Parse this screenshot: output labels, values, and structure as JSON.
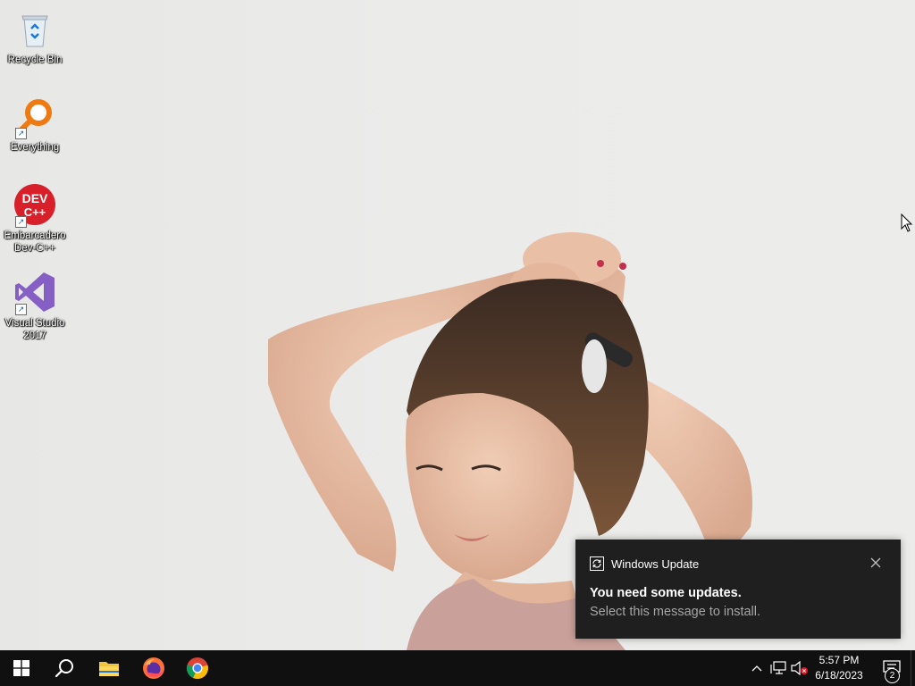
{
  "desktop": {
    "icons": [
      {
        "label": "Recycle Bin",
        "icon": "recycle-bin-icon"
      },
      {
        "label": "Everything",
        "icon": "everything-search-icon"
      },
      {
        "label": "Embarcadero Dev-C++",
        "icon": "devcpp-icon",
        "glyph_text": "DEV C++"
      },
      {
        "label": "Visual Studio 2017",
        "icon": "visual-studio-icon"
      }
    ]
  },
  "notification": {
    "app_name": "Windows Update",
    "title": "You need some updates.",
    "body": "Select this message to install.",
    "close_glyph": "✕"
  },
  "taskbar": {
    "pinned": [
      {
        "name": "start-button",
        "icon": "windows-logo-icon"
      },
      {
        "name": "search-button",
        "icon": "search-icon"
      },
      {
        "name": "file-explorer",
        "icon": "folder-icon"
      },
      {
        "name": "firefox",
        "icon": "firefox-icon"
      },
      {
        "name": "chrome",
        "icon": "chrome-icon"
      }
    ],
    "tray": {
      "chevron": "^",
      "time": "5:57 PM",
      "date": "6/18/2023",
      "notification_count": "2"
    }
  },
  "colors": {
    "taskbar": "#101010",
    "toast_bg": "#1f1f1f",
    "toast_body": "#a6a6a6",
    "windows_blue": "#0078d7"
  }
}
